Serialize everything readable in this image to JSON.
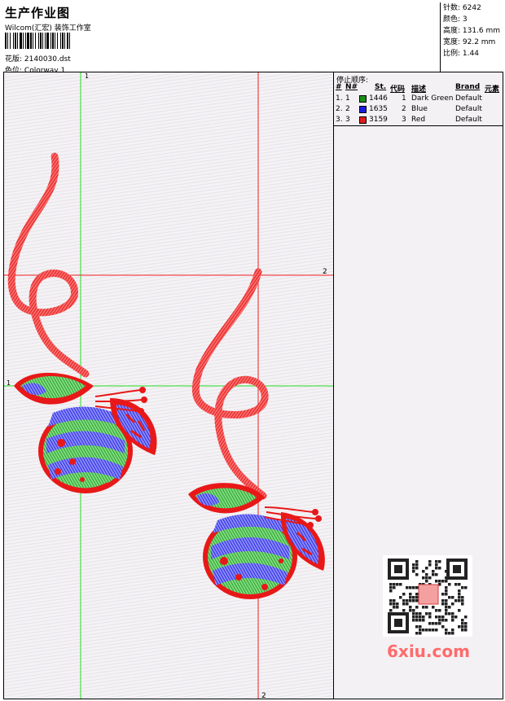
{
  "header": {
    "title": "生产作业图",
    "company": "Wilcom(汇宏) 装饰工作室",
    "design_label": "花版:",
    "design_value": "2140030.dst",
    "colorway_label": "色位:",
    "colorway_value": "Colorway 1"
  },
  "stats": {
    "stitches": "针数: 6242",
    "colors": "颜色: 3",
    "height": "高度: 131.6 mm",
    "width": "宽度: 92.2 mm",
    "scale": "比例: 1.44"
  },
  "stops": {
    "title": "停止顺序:",
    "headers": {
      "num": "#",
      "n": "N#",
      "st": "St.",
      "code": "代码",
      "desc": "描述",
      "brand": "Brand",
      "element": "元素"
    },
    "rows": [
      {
        "num": "1.",
        "n": "1",
        "color": "#1a8f1a",
        "st": "1446",
        "code": "1",
        "desc": "Dark Green",
        "brand": "Default"
      },
      {
        "num": "2.",
        "n": "2",
        "color": "#1c1ce0",
        "st": "1635",
        "code": "2",
        "desc": "Blue",
        "brand": "Default"
      },
      {
        "num": "3.",
        "n": "3",
        "color": "#e01c1c",
        "st": "3159",
        "code": "3",
        "desc": "Red",
        "brand": "Default"
      }
    ]
  },
  "guides": {
    "v1_label": "1",
    "v2_label": "2",
    "h1_label": "1",
    "h2_label": "2"
  },
  "colors": {
    "red": "#e81818",
    "green": "#1e9e1e",
    "blue": "#1e1ee0",
    "guide_green": "#22dd22",
    "guide_red": "#ee2222"
  },
  "watermark": {
    "logo": "6xiu.com"
  }
}
